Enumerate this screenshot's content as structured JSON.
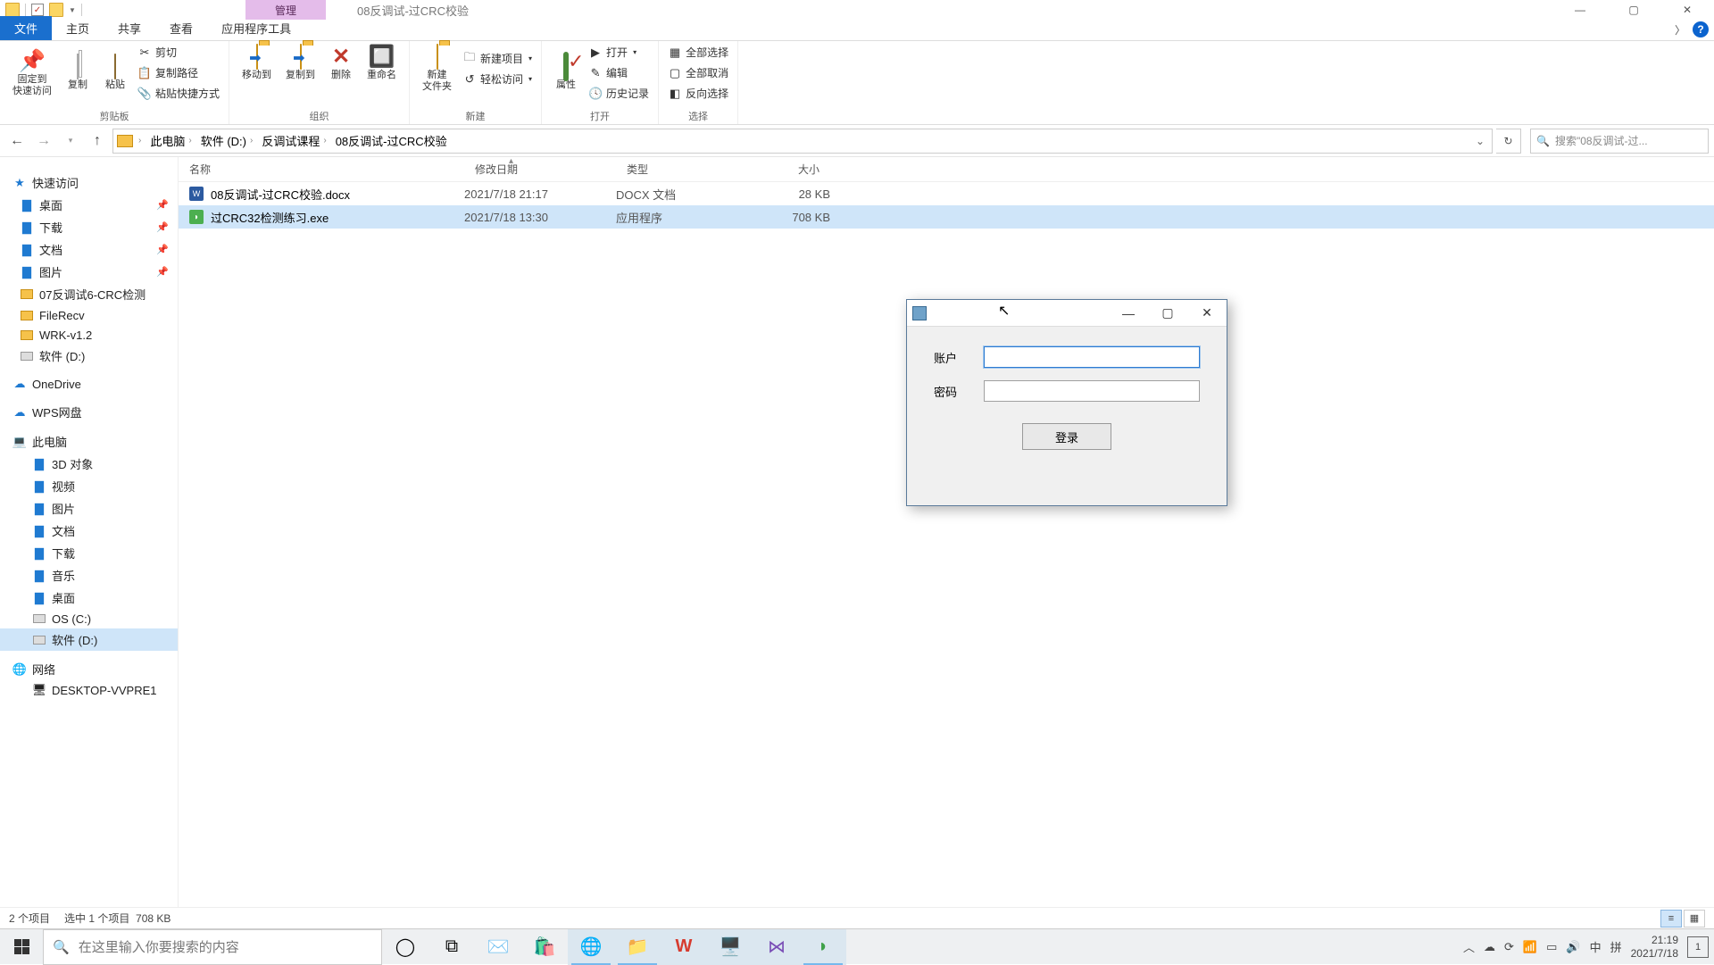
{
  "titlebar": {
    "contextual_tab": "管理",
    "title": "08反调试-过CRC校验"
  },
  "tabs": {
    "file": "文件",
    "home": "主页",
    "share": "共享",
    "view": "查看",
    "app_tools": "应用程序工具"
  },
  "ribbon": {
    "clipboard": {
      "pin": "固定到\n快速访问",
      "copy": "复制",
      "paste": "粘贴",
      "cut": "剪切",
      "copy_path": "复制路径",
      "paste_shortcut": "粘贴快捷方式",
      "label": "剪贴板"
    },
    "organize": {
      "move_to": "移动到",
      "copy_to": "复制到",
      "delete": "删除",
      "rename": "重命名",
      "label": "组织"
    },
    "new": {
      "new_folder": "新建\n文件夹",
      "new_item": "新建项目",
      "easy_access": "轻松访问",
      "label": "新建"
    },
    "open": {
      "properties": "属性",
      "open": "打开",
      "edit": "编辑",
      "history": "历史记录",
      "label": "打开"
    },
    "select": {
      "select_all": "全部选择",
      "select_none": "全部取消",
      "invert": "反向选择",
      "label": "选择"
    }
  },
  "breadcrumb": {
    "items": [
      "此电脑",
      "软件 (D:)",
      "反调试课程",
      "08反调试-过CRC校验"
    ],
    "search_placeholder": "搜索\"08反调试-过..."
  },
  "columns": {
    "name": "名称",
    "date": "修改日期",
    "type": "类型",
    "size": "大小"
  },
  "files": [
    {
      "name": "08反调试-过CRC校验.docx",
      "date": "2021/7/18 21:17",
      "type": "DOCX 文档",
      "size": "28 KB",
      "selected": false,
      "kind": "docx"
    },
    {
      "name": "过CRC32检测练习.exe",
      "date": "2021/7/18 13:30",
      "type": "应用程序",
      "size": "708 KB",
      "selected": true,
      "kind": "exe"
    }
  ],
  "sidebar": {
    "quick_access": "快速访问",
    "qa_items": [
      {
        "label": "桌面",
        "pinned": true,
        "icon": "blue"
      },
      {
        "label": "下载",
        "pinned": true,
        "icon": "blue"
      },
      {
        "label": "文档",
        "pinned": true,
        "icon": "blue"
      },
      {
        "label": "图片",
        "pinned": true,
        "icon": "blue"
      },
      {
        "label": "07反调试6-CRC检测",
        "pinned": false,
        "icon": "folder"
      },
      {
        "label": "FileRecv",
        "pinned": false,
        "icon": "folder"
      },
      {
        "label": "WRK-v1.2",
        "pinned": false,
        "icon": "folder"
      },
      {
        "label": "软件 (D:)",
        "pinned": false,
        "icon": "drive"
      }
    ],
    "onedrive": "OneDrive",
    "wps": "WPS网盘",
    "this_pc": "此电脑",
    "pc_items": [
      {
        "label": "3D 对象"
      },
      {
        "label": "视频"
      },
      {
        "label": "图片"
      },
      {
        "label": "文档"
      },
      {
        "label": "下载"
      },
      {
        "label": "音乐"
      },
      {
        "label": "桌面"
      },
      {
        "label": "OS (C:)"
      },
      {
        "label": "软件 (D:)",
        "selected": true
      }
    ],
    "network": "网络",
    "net_items": [
      {
        "label": "DESKTOP-VVPRE1"
      }
    ]
  },
  "status": {
    "count": "2 个项目",
    "selection": "选中 1 个项目",
    "sel_size": "708 KB"
  },
  "dialog": {
    "user_label": "账户",
    "pass_label": "密码",
    "login": "登录"
  },
  "taskbar": {
    "search_placeholder": "在这里输入你要搜索的内容"
  },
  "tray": {
    "ime1": "中",
    "ime2": "拼",
    "time": "21:19",
    "date": "2021/7/18",
    "notif": "1"
  }
}
